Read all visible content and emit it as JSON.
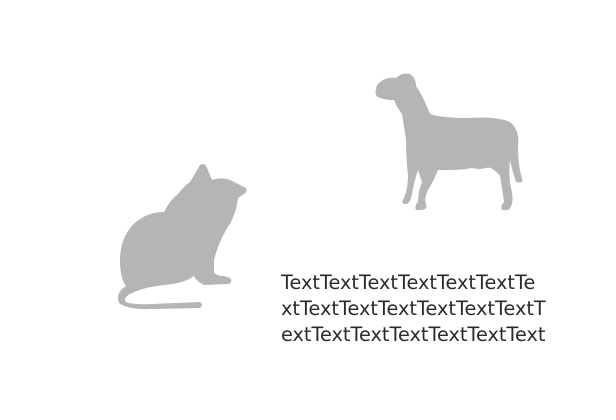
{
  "colors": {
    "background": "#ffffff",
    "silhouette": "#b5b5b5",
    "text": "#2b2b2b"
  },
  "illustrations": {
    "cat": {
      "icon": "cat-silhouette-icon"
    },
    "dog": {
      "icon": "dog-silhouette-icon"
    }
  },
  "text_block": {
    "lines": [
      "TextTextTextTextTextTextTe",
      "xtTextTextTextTextTextTextT",
      "extTextTextTextTextTextText"
    ]
  }
}
